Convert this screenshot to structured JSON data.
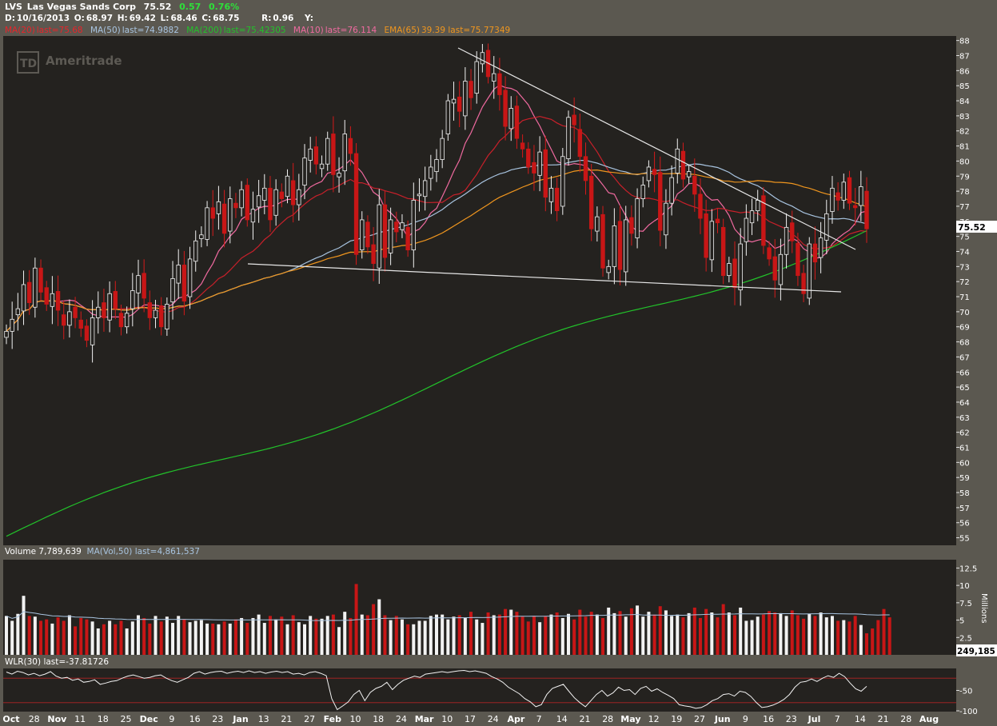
{
  "header": {
    "symbol": "LVS",
    "name": "Las Vegas Sands Corp",
    "last": "75.52",
    "change": "0.57",
    "change_pct": "0.76%",
    "d_label": "D:",
    "date": "10/16/2013",
    "o_label": "O:",
    "open": "68.97",
    "h_label": "H:",
    "high": "69.42",
    "l_label": "L:",
    "low": "68.46",
    "c_label": "C:",
    "close": "68.75",
    "r_label": "R:",
    "range": "0.96",
    "y_label": "Y:"
  },
  "studies": [
    {
      "label": "MA(20)",
      "value": "last=75.68",
      "color": "#e8242a"
    },
    {
      "label": "MA(50)",
      "value": "last=74.9882",
      "color": "#a8c4e0"
    },
    {
      "label": "MA(200)",
      "value": "last=75.42305",
      "color": "#22c22a"
    },
    {
      "label": "MA(10)",
      "value": "last=76.114",
      "color": "#f06aa0"
    },
    {
      "label": "EMA(65)",
      "value": "39.39 last=75.77349",
      "color": "#f0961e"
    }
  ],
  "volume_header": {
    "label": "Volume",
    "value": "7,789,639",
    "ma_label": "MA(Vol,50)",
    "ma_value": "last=4,861,537"
  },
  "wlr_header": {
    "label": "WLR(30)",
    "value": "last=-37.81726"
  },
  "logo": {
    "text": "Ameritrade",
    "mark": "TD"
  },
  "price_tag": "75.52",
  "volume_tag": "249,185",
  "volume_unit": "Millions",
  "chart_data": {
    "type": "candlestick",
    "price_ylim": [
      54.5,
      88.3
    ],
    "price_ticks": [
      "55",
      "56",
      "57",
      "58",
      "59",
      "60",
      "61",
      "62",
      "63",
      "64",
      "65",
      "66",
      "67",
      "68",
      "69",
      "70",
      "71",
      "72",
      "73",
      "74",
      "75",
      "76",
      "77",
      "78",
      "79",
      "80",
      "81",
      "82",
      "83",
      "84",
      "85",
      "86",
      "87",
      "88"
    ],
    "volume_ticks": [
      "2.5",
      "5",
      "7.5",
      "10",
      "12.5"
    ],
    "wlr_ticks": [
      "-50",
      "-100"
    ],
    "x_ticks": [
      "Oct",
      "28",
      "Nov",
      "11",
      "18",
      "25",
      "Dec",
      "9",
      "16",
      "23",
      "Jan",
      "13",
      "21",
      "27",
      "Feb",
      "10",
      "18",
      "24",
      "Mar",
      "10",
      "17",
      "24",
      "Apr",
      "7",
      "14",
      "21",
      "28",
      "May",
      "12",
      "19",
      "27",
      "Jun",
      "9",
      "16",
      "23",
      "Jul",
      "7",
      "14",
      "21",
      "28",
      "Aug"
    ],
    "x_tick_labels_bold": [
      "Oct",
      "Nov",
      "Dec",
      "Jan",
      "Feb",
      "Mar",
      "Apr",
      "May",
      "Jun",
      "Jul",
      "Aug"
    ],
    "close_series": [
      68.7,
      69.5,
      70.2,
      71.8,
      70.6,
      72.9,
      71.3,
      70.5,
      71.2,
      70.1,
      69.1,
      70.0,
      69.6,
      68.9,
      68.1,
      69.6,
      70.3,
      69.6,
      71.2,
      70.2,
      69.0,
      69.9,
      71.4,
      72.4,
      70.9,
      69.6,
      70.1,
      69.0,
      70.5,
      72.2,
      73.1,
      70.7,
      73.5,
      74.7,
      75.1,
      76.9,
      76.2,
      77.3,
      75.2,
      77.5,
      76.9,
      78.1,
      76.1,
      76.8,
      77.7,
      78.2,
      76.1,
      78.1,
      77.5,
      79.0,
      77.1,
      78.1,
      80.2,
      80.8,
      79.8,
      79.8,
      81.5,
      79.1,
      79.2,
      81.8,
      80.5,
      73.8,
      76.1,
      74.3,
      73.2,
      77.1,
      73.6,
      76.1,
      75.3,
      75.9,
      74.1,
      77.4,
      77.8,
      78.7,
      79.6,
      80.1,
      81.5,
      84.0,
      84.1,
      83.3,
      85.3,
      84.2,
      86.6,
      87.2,
      85.6,
      85.8,
      84.4,
      82.3,
      83.5,
      81.5,
      80.8,
      79.6,
      79.2,
      80.6,
      77.6,
      78.2,
      76.7,
      80.3,
      82.9,
      82.4,
      80.3,
      78.7,
      75.5,
      76.3,
      72.9,
      73.0,
      75.7,
      72.8,
      76.1,
      75.2,
      77.5,
      78.4,
      79.6,
      79.1,
      75.4,
      77.2,
      78.9,
      80.8,
      78.8,
      79.3,
      77.8,
      76.2,
      73.6,
      76.0,
      75.9,
      72.4,
      73.2,
      71.6,
      74.5,
      76.2,
      76.7,
      77.4,
      74.4,
      73.5,
      72.1,
      73.8,
      75.6,
      74.7,
      72.4,
      71.2,
      74.5,
      73.3,
      74.9,
      76.5,
      78.2,
      77.4,
      78.6,
      77.2,
      76.9,
      78.3,
      75.5
    ],
    "volume_series": [
      5.6,
      4.9,
      5.9,
      8.5,
      5.6,
      5.5,
      4.9,
      5.1,
      4.5,
      5.4,
      4.9,
      5.7,
      4.1,
      5.3,
      5.1,
      4.8,
      3.8,
      4.4,
      4.9,
      4.4,
      4.9,
      3.8,
      4.8,
      5.7,
      5.3,
      4.5,
      5.6,
      4.8,
      5.5,
      4.6,
      5.6,
      5.1,
      4.7,
      4.9,
      5.0,
      4.5,
      4.5,
      4.4,
      4.8,
      4.5,
      5.1,
      5.3,
      4.6,
      5.3,
      5.8,
      4.6,
      5.6,
      5.1,
      5.5,
      4.4,
      5.7,
      4.7,
      4.4,
      5.6,
      5.2,
      5.2,
      5.6,
      5.8,
      4.0,
      6.2,
      5.3,
      10.2,
      5.8,
      5.7,
      7.3,
      8.0,
      5.7,
      5.0,
      5.6,
      5.1,
      4.4,
      4.4,
      4.9,
      4.9,
      5.6,
      5.8,
      5.8,
      5.1,
      5.5,
      5.7,
      5.3,
      6.2,
      5.1,
      4.6,
      6.1,
      5.7,
      5.8,
      6.6,
      6.5,
      6.2,
      5.5,
      4.8,
      5.6,
      4.7,
      5.6,
      5.8,
      6.1,
      5.3,
      5.9,
      5.1,
      6.5,
      5.5,
      6.2,
      5.8,
      5.3,
      6.8,
      6.0,
      6.3,
      5.5,
      6.7,
      7.1,
      5.5,
      6.2,
      5.8,
      7.0,
      6.4,
      5.6,
      5.8,
      5.4,
      6.0,
      6.8,
      5.3,
      6.6,
      6.1,
      5.4,
      7.3,
      6.1,
      5.7,
      6.8,
      4.9,
      5.0,
      5.5,
      5.8,
      6.3,
      6.1,
      6.0,
      5.6,
      6.4,
      5.7,
      5.2,
      5.9,
      5.6,
      6.1,
      5.4,
      5.6,
      4.9,
      5.0,
      4.8,
      5.6,
      4.3,
      3.1,
      3.8,
      5.0,
      6.6,
      5.4
    ],
    "wlr_series": [
      -5,
      -10,
      -3,
      -6,
      -12,
      -8,
      -14,
      -10,
      -4,
      -15,
      -20,
      -18,
      -25,
      -22,
      -30,
      -28,
      -24,
      -35,
      -32,
      -28,
      -26,
      -20,
      -15,
      -12,
      -16,
      -20,
      -18,
      -14,
      -12,
      -20,
      -26,
      -30,
      -24,
      -18,
      -8,
      -4,
      -10,
      -6,
      -4,
      -3,
      -8,
      -5,
      -3,
      -6,
      -2,
      -6,
      -4,
      -8,
      -5,
      -3,
      -6,
      -4,
      -10,
      -8,
      -12,
      -6,
      -4,
      -8,
      -14,
      -70,
      -97,
      -88,
      -78,
      -60,
      -50,
      -75,
      -55,
      -45,
      -40,
      -30,
      -48,
      -35,
      -25,
      -20,
      -15,
      -18,
      -10,
      -8,
      -6,
      -4,
      -6,
      -4,
      -2,
      -1,
      -4,
      -2,
      -5,
      -8,
      -16,
      -22,
      -30,
      -42,
      -50,
      -58,
      -70,
      -78,
      -90,
      -85,
      -60,
      -45,
      -40,
      -35,
      -52,
      -68,
      -80,
      -90,
      -75,
      -60,
      -50,
      -64,
      -56,
      -42,
      -50,
      -48,
      -60,
      -45,
      -40,
      -52,
      -46,
      -55,
      -62,
      -70,
      -85,
      -88,
      -90,
      -94,
      -92,
      -85,
      -75,
      -70,
      -60,
      -58,
      -64,
      -52,
      -55,
      -65,
      -80,
      -92,
      -90,
      -86,
      -80,
      -72,
      -60,
      -42,
      -30,
      -28,
      -22,
      -28,
      -20,
      -14,
      -18,
      -8,
      -16,
      -32,
      -46,
      -52,
      -40
    ]
  }
}
